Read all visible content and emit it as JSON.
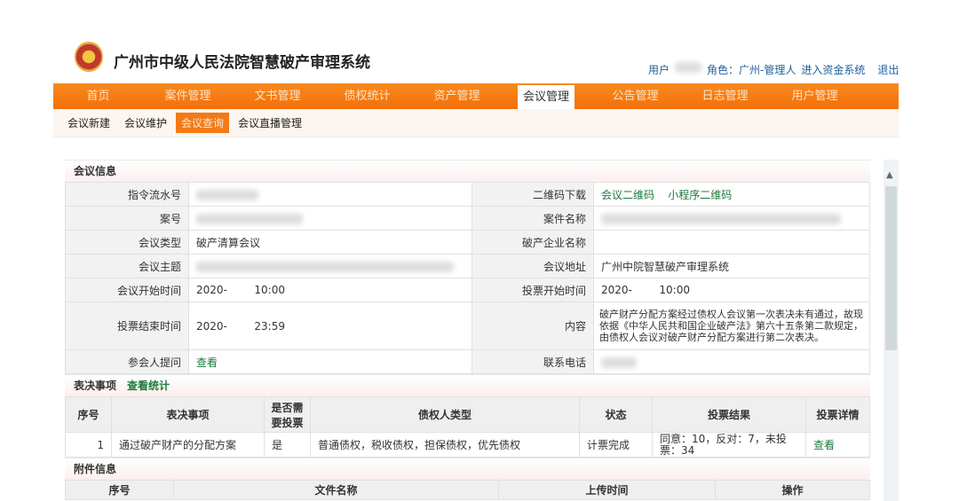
{
  "header": {
    "title": "广州市中级人民法院智慧破产审理系统",
    "user_label": "用户",
    "role": "角色：广州-管理人",
    "fund_link": "进入资金系统",
    "logout": "退出"
  },
  "nav": [
    "首页",
    "案件管理",
    "文书管理",
    "债权统计",
    "资产管理",
    "会议管理",
    "公告管理",
    "日志管理",
    "用户管理"
  ],
  "subnav": [
    "会议新建",
    "会议维护",
    "会议查询",
    "会议直播管理"
  ],
  "meeting": {
    "section": "会议信息",
    "rows": [
      {
        "l1": "指令流水号",
        "v1": "",
        "l2": "二维码下载",
        "links": [
          "会议二维码",
          "小程序二维码"
        ]
      },
      {
        "l1": "案号",
        "v1": "",
        "l2": "案件名称",
        "v2": ""
      },
      {
        "l1": "会议类型",
        "v1": "破产清算会议",
        "l2": "破产企业名称",
        "v2": ""
      },
      {
        "l1": "会议主题",
        "v1": "",
        "l2": "会议地址",
        "v2": "广州中院智慧破产审理系统"
      },
      {
        "l1": "会议开始时间",
        "v1": "2020-        10:00",
        "l2": "投票开始时间",
        "v2": "2020-        10:00"
      },
      {
        "l1": "投票结束时间",
        "v1": "2020-        23:59",
        "l2": "内容",
        "v2": "破产财产分配方案经过债权人会议第一次表决未有通过，故现依据《中华人民共和国企业破产法》第六十五条第二款规定，由债权人会议对破产财产分配方案进行第二次表决。"
      },
      {
        "l1": "参会人提问",
        "v1link": "查看",
        "l2": "联系电话",
        "v2": ""
      }
    ]
  },
  "votes": {
    "section": "表决事项",
    "stats_link": "查看统计",
    "headers": [
      "序号",
      "表决事项",
      "是否需要投票",
      "债权人类型",
      "状态",
      "投票结果",
      "投票详情"
    ],
    "rows": [
      {
        "no": "1",
        "item": "通过破产财产的分配方案",
        "need": "是",
        "types": "普通债权，税收债权，担保债权，优先债权",
        "status": "计票完成",
        "result": "同意：10，反对：7，未投票：34",
        "detail": "查看"
      }
    ]
  },
  "attachments": {
    "section": "附件信息",
    "headers": [
      "序号",
      "文件名称",
      "上传时间",
      "操作"
    ]
  }
}
